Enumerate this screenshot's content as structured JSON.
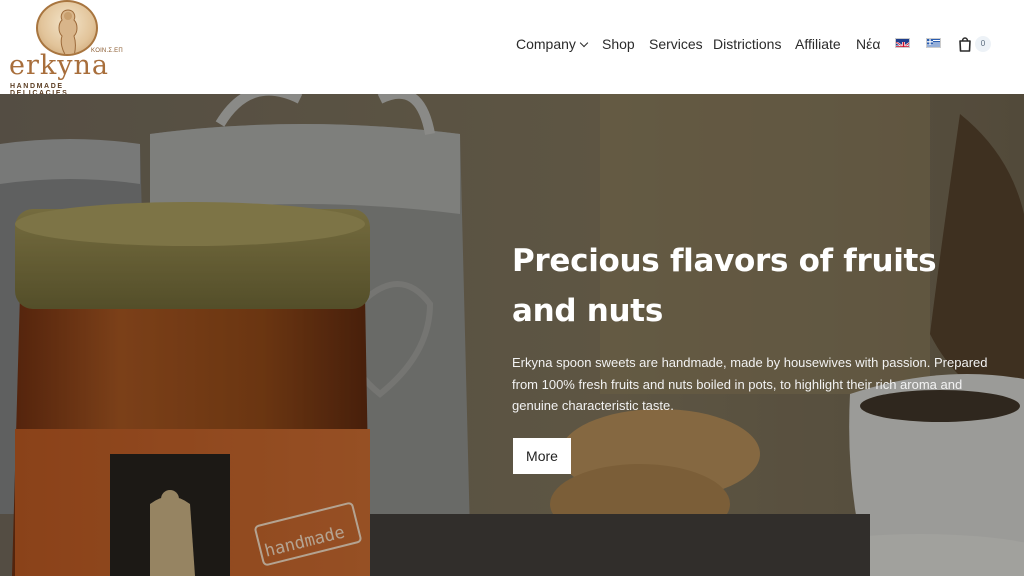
{
  "logo": {
    "small_text": "KOIN.Σ.ΕΠ",
    "wordmark": "erkyna",
    "tagline": "HANDMADE DELICACIES"
  },
  "nav": {
    "items": [
      {
        "label": "Company",
        "has_dropdown": true
      },
      {
        "label": "Shop"
      },
      {
        "label": "Services"
      },
      {
        "label": "Districtions"
      },
      {
        "label": "Affiliate"
      },
      {
        "label": "Νέα"
      }
    ],
    "flags": [
      "english-flag-icon",
      "greek-flag-icon"
    ],
    "cart_count": "0"
  },
  "hero": {
    "title": "Precious flavors of fruits and nuts",
    "text": "Erkyna spoon sweets are handmade, made by housewives with passion. Prepared from 100% fresh fruits and nuts boiled in pots, to highlight their rich aroma and genuine characteristic taste.",
    "button_label": "More",
    "jar_label": "handmade"
  },
  "colors": {
    "brand": "#a86e3b",
    "nav_text": "#2b2b2b",
    "button_bg": "#ffffff"
  }
}
